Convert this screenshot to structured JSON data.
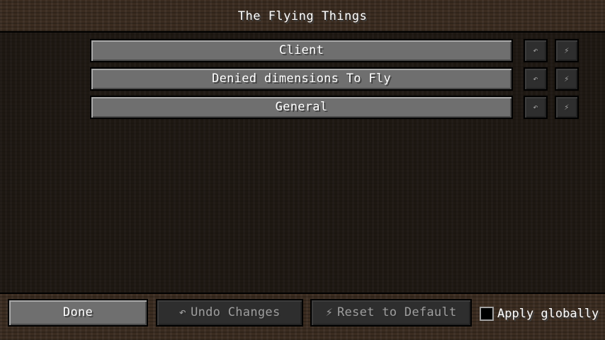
{
  "header": {
    "title": "The Flying Things"
  },
  "categories": [
    {
      "label": "Client",
      "undo_icon": "↶",
      "reset_icon": "⚡"
    },
    {
      "label": "Denied dimensions To Fly",
      "undo_icon": "↶",
      "reset_icon": "⚡"
    },
    {
      "label": "General",
      "undo_icon": "↶",
      "reset_icon": "⚡"
    }
  ],
  "footer": {
    "done_label": "Done",
    "undo_icon": "↶",
    "undo_label": "Undo Changes",
    "reset_icon": "⚡",
    "reset_label": "Reset to Default",
    "apply_globally_label": "Apply globally",
    "apply_globally_checked": false
  },
  "icons": {
    "undo": "undo-icon",
    "reset": "reset-icon"
  },
  "colors": {
    "button_face": "#6f6f6f",
    "button_disabled": "#2e2e2e",
    "text": "#ffffff",
    "disabled_text": "#9e9e9e",
    "dirt_dark": "#1e1812",
    "dirt_band": "#3b2c20"
  }
}
